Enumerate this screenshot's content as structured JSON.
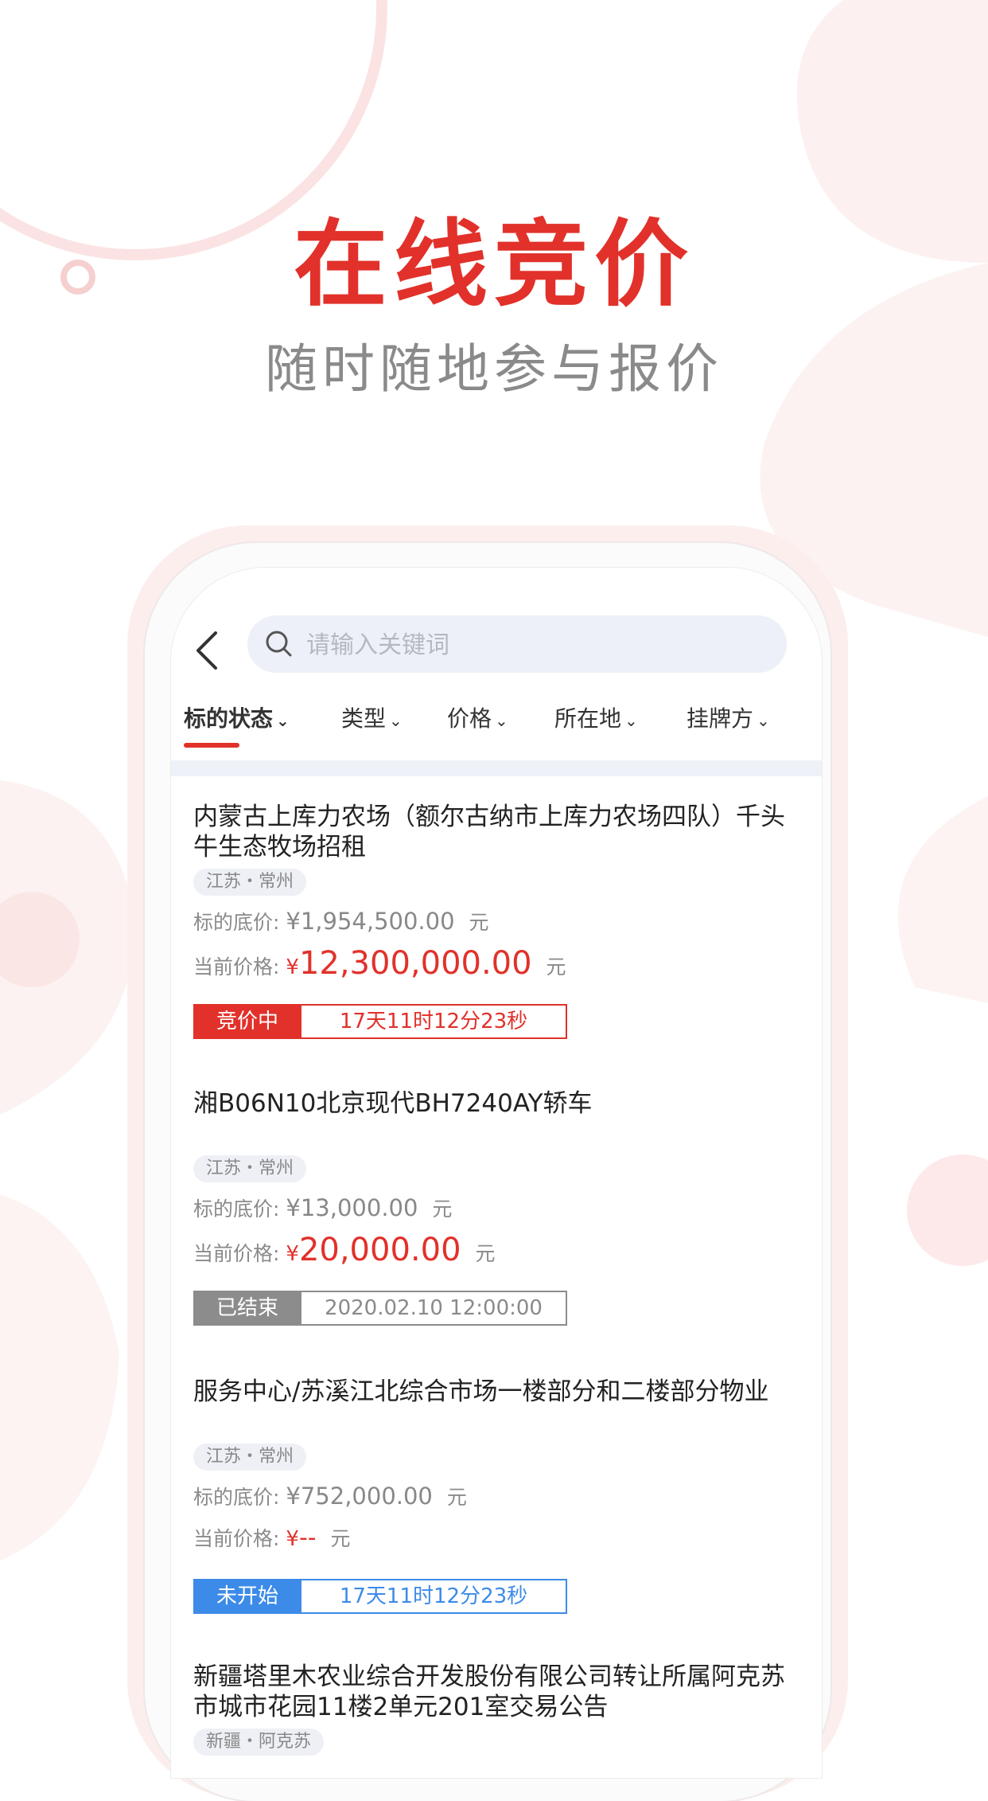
{
  "hero": {
    "title": "在线竞价",
    "subtitle": "随时随地参与报价"
  },
  "colors": {
    "accent": "#e1312a",
    "blue": "#3d8be8",
    "gray": "#8c8c8c"
  },
  "search": {
    "placeholder": "请输入关键词"
  },
  "filters": [
    {
      "label": "标的状态",
      "active": true
    },
    {
      "label": "类型",
      "active": false
    },
    {
      "label": "价格",
      "active": false
    },
    {
      "label": "所在地",
      "active": false
    },
    {
      "label": "挂牌方",
      "active": false
    }
  ],
  "labels": {
    "base_price": "标的底价:",
    "current_price": "当前价格:",
    "unit": "元",
    "yen": "¥"
  },
  "items": [
    {
      "title": "内蒙古上库力农场（额尔古纳市上库力农场四队）千头牛生态牧场招租",
      "location": "江苏・常州",
      "base_price": "¥1,954,500.00",
      "current_price": "12,300,000.00",
      "status": "竞价中",
      "status_info": "17天11时12分23秒"
    },
    {
      "title": "湘B06N10北京现代BH7240AY轿车",
      "location": "江苏・常州",
      "base_price": "¥13,000.00",
      "current_price": "20,000.00",
      "status": "已结束",
      "status_info": "2020.02.10 12:00:00"
    },
    {
      "title": "服务中心/苏溪江北综合市场一楼部分和二楼部分物业",
      "location": "江苏・常州",
      "base_price": "¥752,000.00",
      "current_price": "--",
      "status": "未开始",
      "status_info": "17天11时12分23秒"
    },
    {
      "title": "新疆塔里木农业综合开发股份有限公司转让所属阿克苏市城市花园11楼2单元201室交易公告",
      "location": "新疆・阿克苏"
    }
  ]
}
